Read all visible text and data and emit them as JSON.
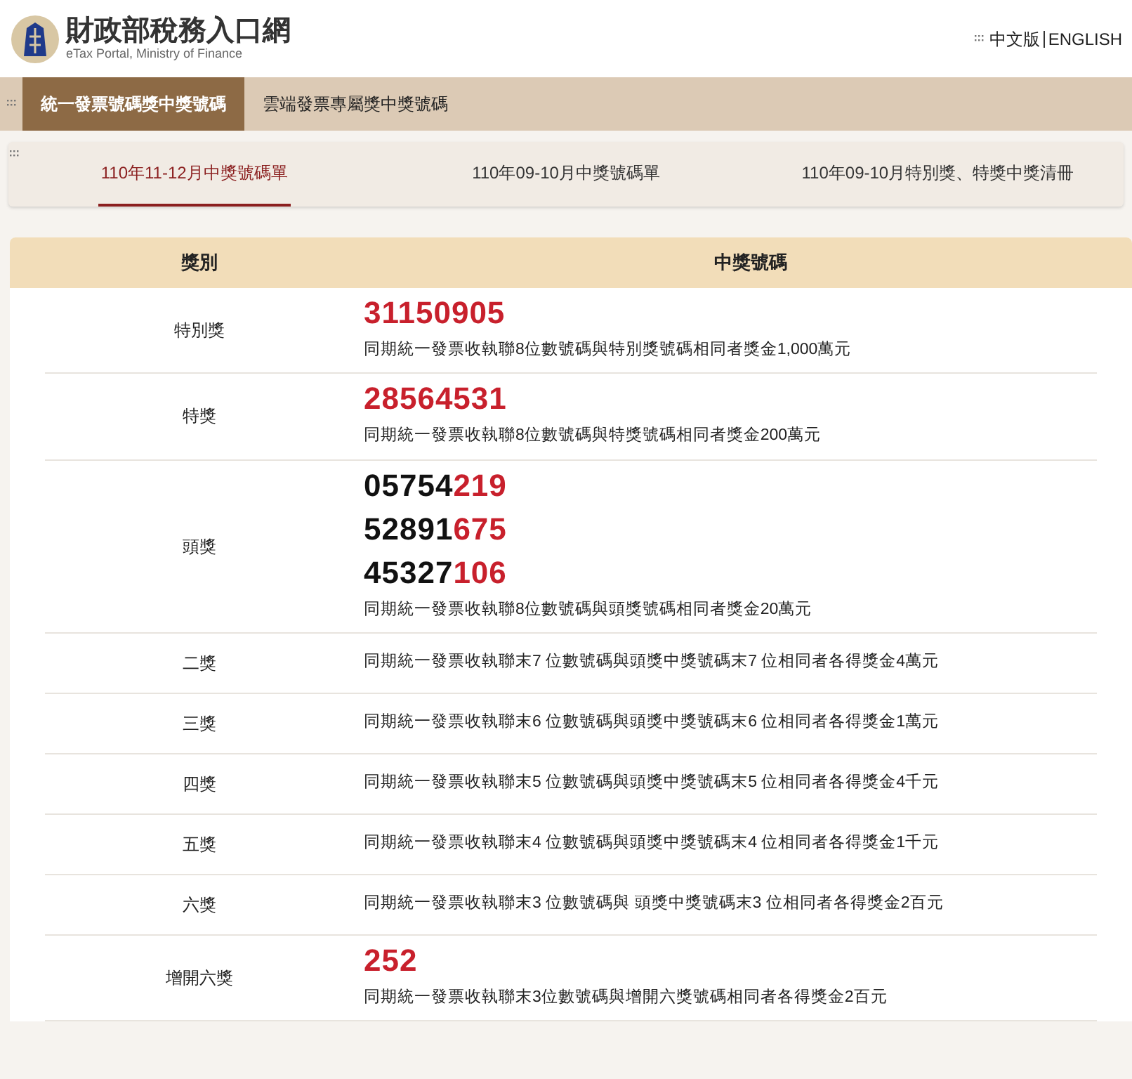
{
  "header": {
    "site_name": "財政部稅務入口網",
    "site_subtitle": "eTax Portal, Ministry of Finance",
    "languages": [
      "中文版",
      "ENGLISH"
    ]
  },
  "main_tabs": [
    {
      "label": "統一發票號碼獎中獎號碼",
      "selected": true
    },
    {
      "label": "雲端發票專屬獎中獎號碼",
      "selected": false
    }
  ],
  "period_tabs": [
    {
      "label": "110年11-12月中獎號碼單",
      "selected": true
    },
    {
      "label": "110年09-10月中獎號碼單",
      "selected": false
    },
    {
      "label": "110年09-10月特別獎、特獎中獎清冊",
      "selected": false
    }
  ],
  "table": {
    "columns": [
      "獎別",
      "中獎號碼"
    ],
    "rows": [
      {
        "prize": "特別獎",
        "numbers": [
          {
            "highlight": "31150905"
          }
        ],
        "description": "同期統一發票收執聯8位數號碼與特別獎號碼相同者獎金1,000萬元"
      },
      {
        "prize": "特獎",
        "numbers": [
          {
            "highlight": "28564531"
          }
        ],
        "description": "同期統一發票收執聯8位數號碼與特獎號碼相同者獎金200萬元"
      },
      {
        "prize": "頭獎",
        "numbers": [
          {
            "plain": "05754",
            "highlight": "219"
          },
          {
            "plain": "52891",
            "highlight": "675"
          },
          {
            "plain": "45327",
            "highlight": "106"
          }
        ],
        "description": "同期統一發票收執聯8位數號碼與頭獎號碼相同者獎金20萬元"
      },
      {
        "prize": "二獎",
        "description": "同期統一發票收執聯末7 位數號碼與頭獎中獎號碼末7 位相同者各得獎金4萬元"
      },
      {
        "prize": "三獎",
        "description": "同期統一發票收執聯末6 位數號碼與頭獎中獎號碼末6 位相同者各得獎金1萬元"
      },
      {
        "prize": "四獎",
        "description": "同期統一發票收執聯末5 位數號碼與頭獎中獎號碼末5 位相同者各得獎金4千元"
      },
      {
        "prize": "五獎",
        "description": "同期統一發票收執聯末4 位數號碼與頭獎中獎號碼末4 位相同者各得獎金1千元"
      },
      {
        "prize": "六獎",
        "description": "同期統一發票收執聯末3 位數號碼與 頭獎中獎號碼末3 位相同者各得獎金2百元"
      },
      {
        "prize": "增開六獎",
        "numbers": [
          {
            "highlight": "252"
          }
        ],
        "description": "同期統一發票收執聯末3位數號碼與增開六獎號碼相同者各得獎金2百元"
      }
    ]
  }
}
